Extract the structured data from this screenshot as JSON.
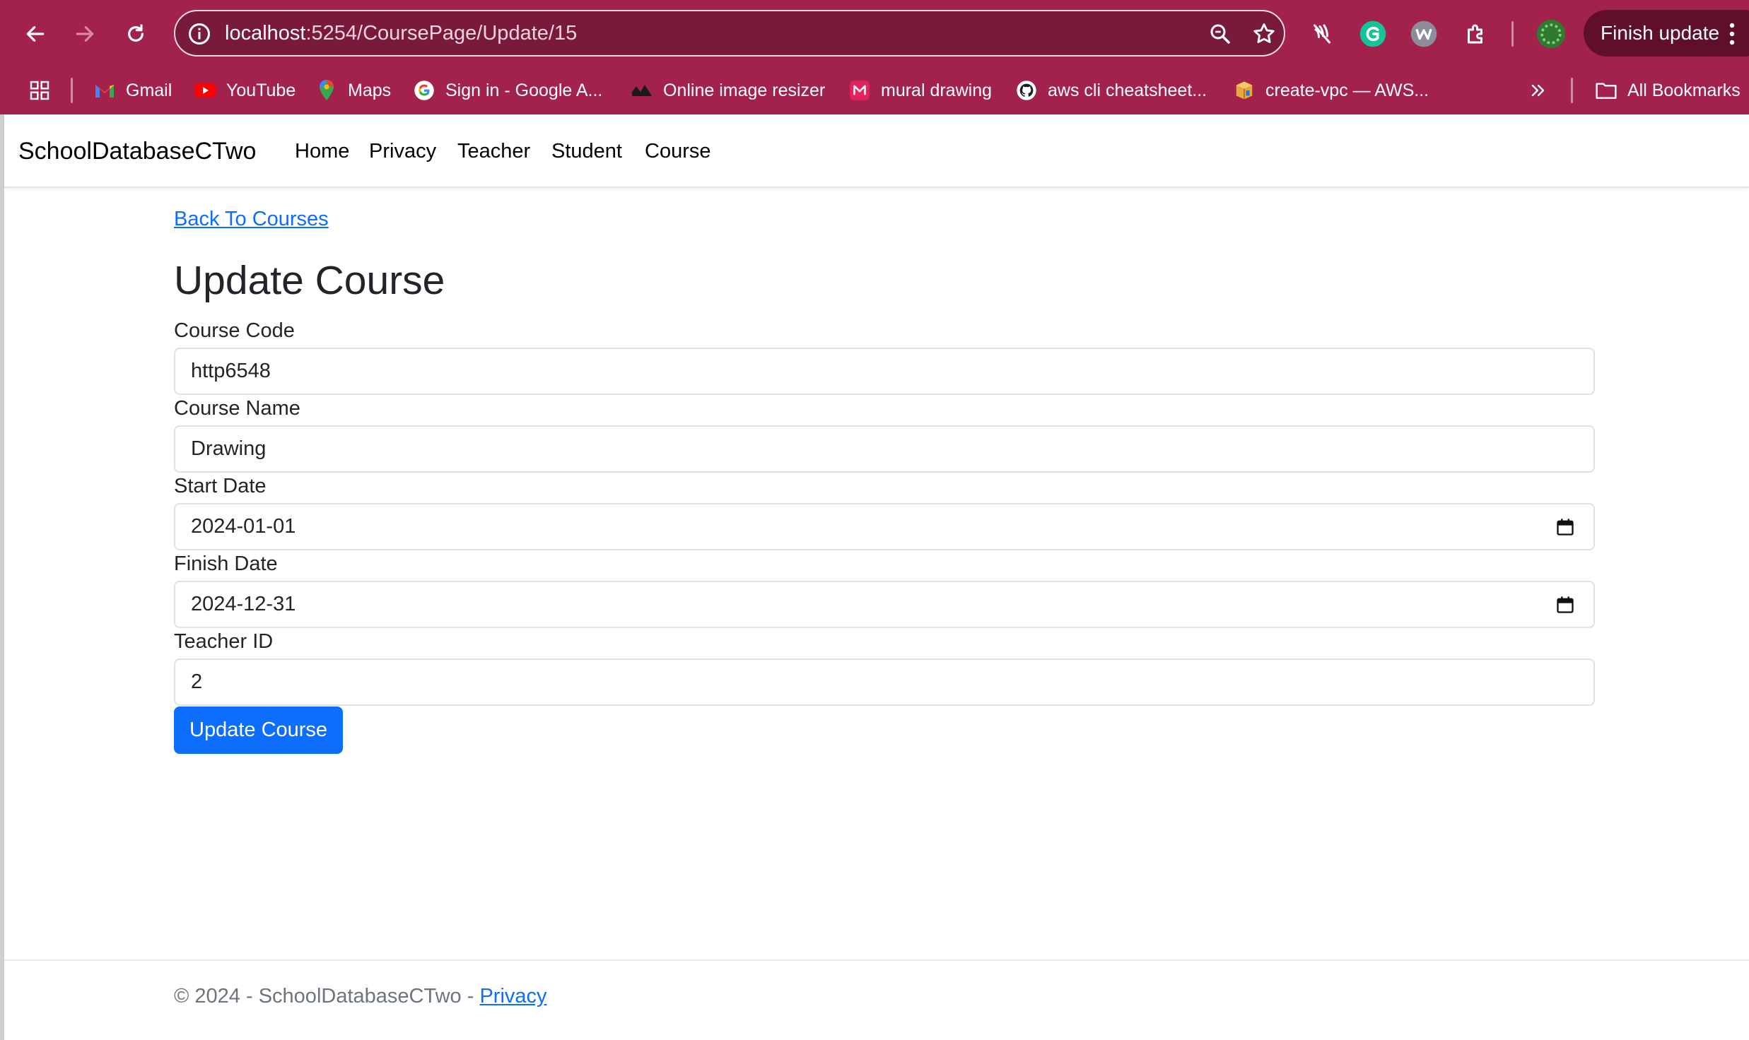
{
  "browser": {
    "url_host": "localhost",
    "url_path": ":5254/CoursePage/Update/15",
    "finish_update_label": "Finish update",
    "bookmarks": [
      {
        "label": "Gmail",
        "icon": "gmail-icon"
      },
      {
        "label": "YouTube",
        "icon": "youtube-icon"
      },
      {
        "label": "Maps",
        "icon": "maps-icon"
      },
      {
        "label": "Sign in - Google A...",
        "icon": "google-icon"
      },
      {
        "label": "Online image resizer",
        "icon": "resizer-icon"
      },
      {
        "label": "mural drawing",
        "icon": "mural-icon"
      },
      {
        "label": "aws cli cheatsheet...",
        "icon": "github-icon"
      },
      {
        "label": "create-vpc — AWS...",
        "icon": "aws-box-icon"
      }
    ],
    "all_bookmarks_label": "All Bookmarks",
    "colors": {
      "frame": "#a3224c",
      "omnibox": "#7a1a39"
    }
  },
  "nav": {
    "brand": "SchoolDatabaseCTwo",
    "links": [
      "Home",
      "Privacy",
      "Teacher",
      "Student",
      "Course"
    ]
  },
  "form": {
    "back_link": "Back To Courses",
    "title": "Update Course",
    "fields": [
      {
        "label": "Course Code",
        "value": "http6548"
      },
      {
        "label": "Course Name",
        "value": "Drawing"
      },
      {
        "label": "Start Date",
        "value": "2024-01-01"
      },
      {
        "label": "Finish Date",
        "value": "2024-12-31"
      },
      {
        "label": "Teacher ID",
        "value": "2"
      }
    ],
    "submit_label": "Update Course",
    "colors": {
      "primary": "#0d6efd"
    }
  },
  "footer": {
    "text": "© 2024 - SchoolDatabaseCTwo - ",
    "link": "Privacy"
  }
}
